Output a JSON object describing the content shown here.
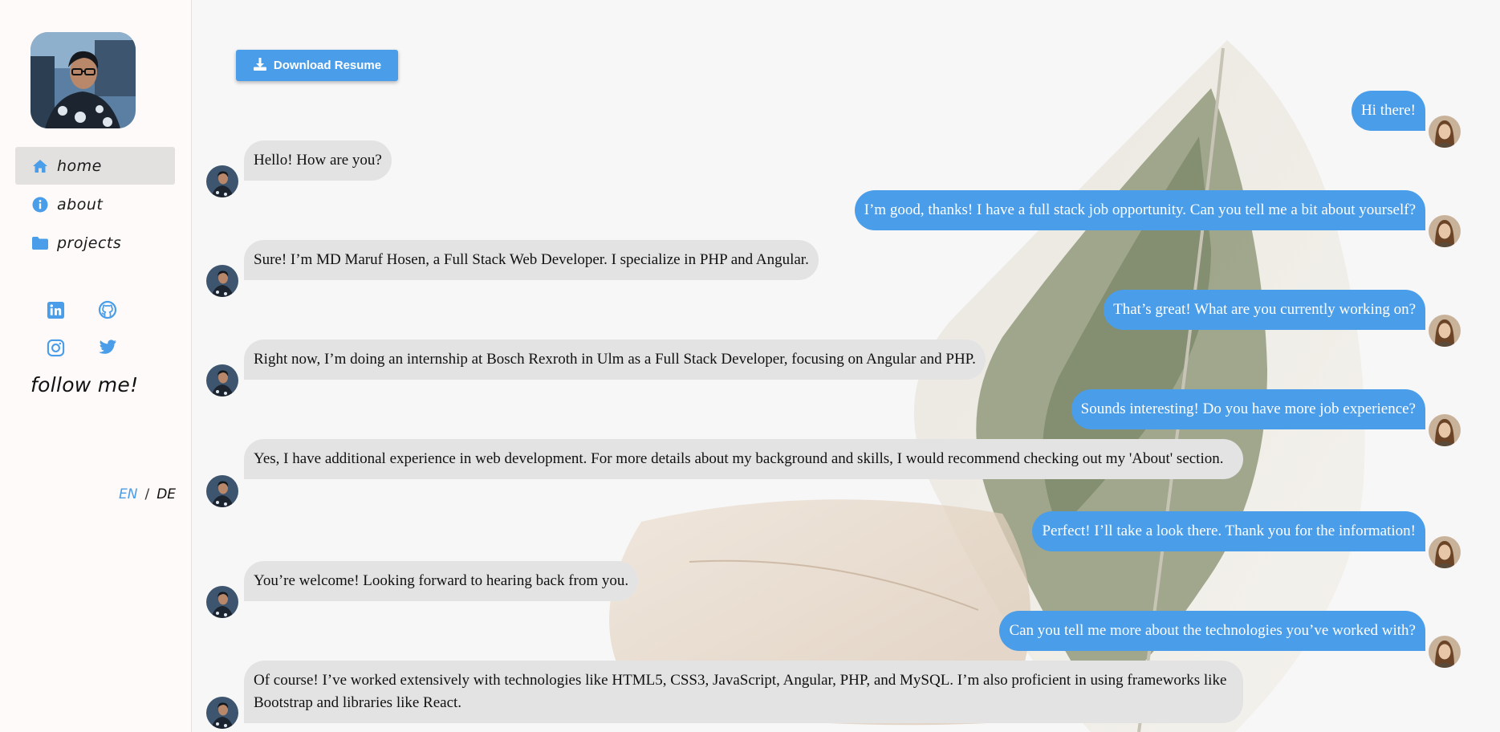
{
  "sidebar": {
    "nav": [
      {
        "label": "home",
        "icon": "home-icon",
        "active": true
      },
      {
        "label": "about",
        "icon": "info-icon",
        "active": false
      },
      {
        "label": "projects",
        "icon": "folder-icon",
        "active": false
      }
    ],
    "social_icons": [
      "linkedin-icon",
      "github-icon",
      "instagram-icon",
      "twitter-icon"
    ],
    "follow_text": "follow me!",
    "lang": {
      "en": "EN",
      "separator": "/",
      "de": "DE",
      "active": "EN"
    }
  },
  "main": {
    "download_label": "Download Resume",
    "messages": [
      {
        "side": "right",
        "text": "Hi there!"
      },
      {
        "side": "left",
        "text": "Hello! How are you?"
      },
      {
        "side": "right",
        "text": "I’m good, thanks! I have a full stack job opportunity. Can you tell me a bit about yourself?"
      },
      {
        "side": "left",
        "text": "Sure! I’m MD Maruf Hosen, a Full Stack Web Developer. I specialize in PHP and Angular."
      },
      {
        "side": "right",
        "text": "That’s great! What are you currently working on?"
      },
      {
        "side": "left",
        "text": "Right now, I’m doing an internship at Bosch Rexroth in Ulm as a Full Stack Developer, focusing on Angular and PHP."
      },
      {
        "side": "right",
        "text": "Sounds interesting! Do you have more job experience?"
      },
      {
        "side": "left",
        "text": "Yes, I have additional experience in web development. For more details about my background and skills, I would recommend checking out my 'About' section."
      },
      {
        "side": "right",
        "text": "Perfect! I’ll take a look there. Thank you for the information!"
      },
      {
        "side": "left",
        "text": "You’re welcome! Looking forward to hearing back from you."
      },
      {
        "side": "right",
        "text": "Can you tell me more about the technologies you’ve worked with?"
      },
      {
        "side": "left",
        "text": "Of course! I’ve worked extensively with technologies like HTML5, CSS3, JavaScript, Angular, PHP, and MySQL. I’m also proficient in using frameworks like Bootstrap and libraries like React."
      }
    ]
  },
  "colors": {
    "accent": "#4a9de8",
    "left_bubble": "#e3e3e4",
    "sidebar_bg": "#fdfaf9",
    "main_bg": "#f7f7f8"
  }
}
